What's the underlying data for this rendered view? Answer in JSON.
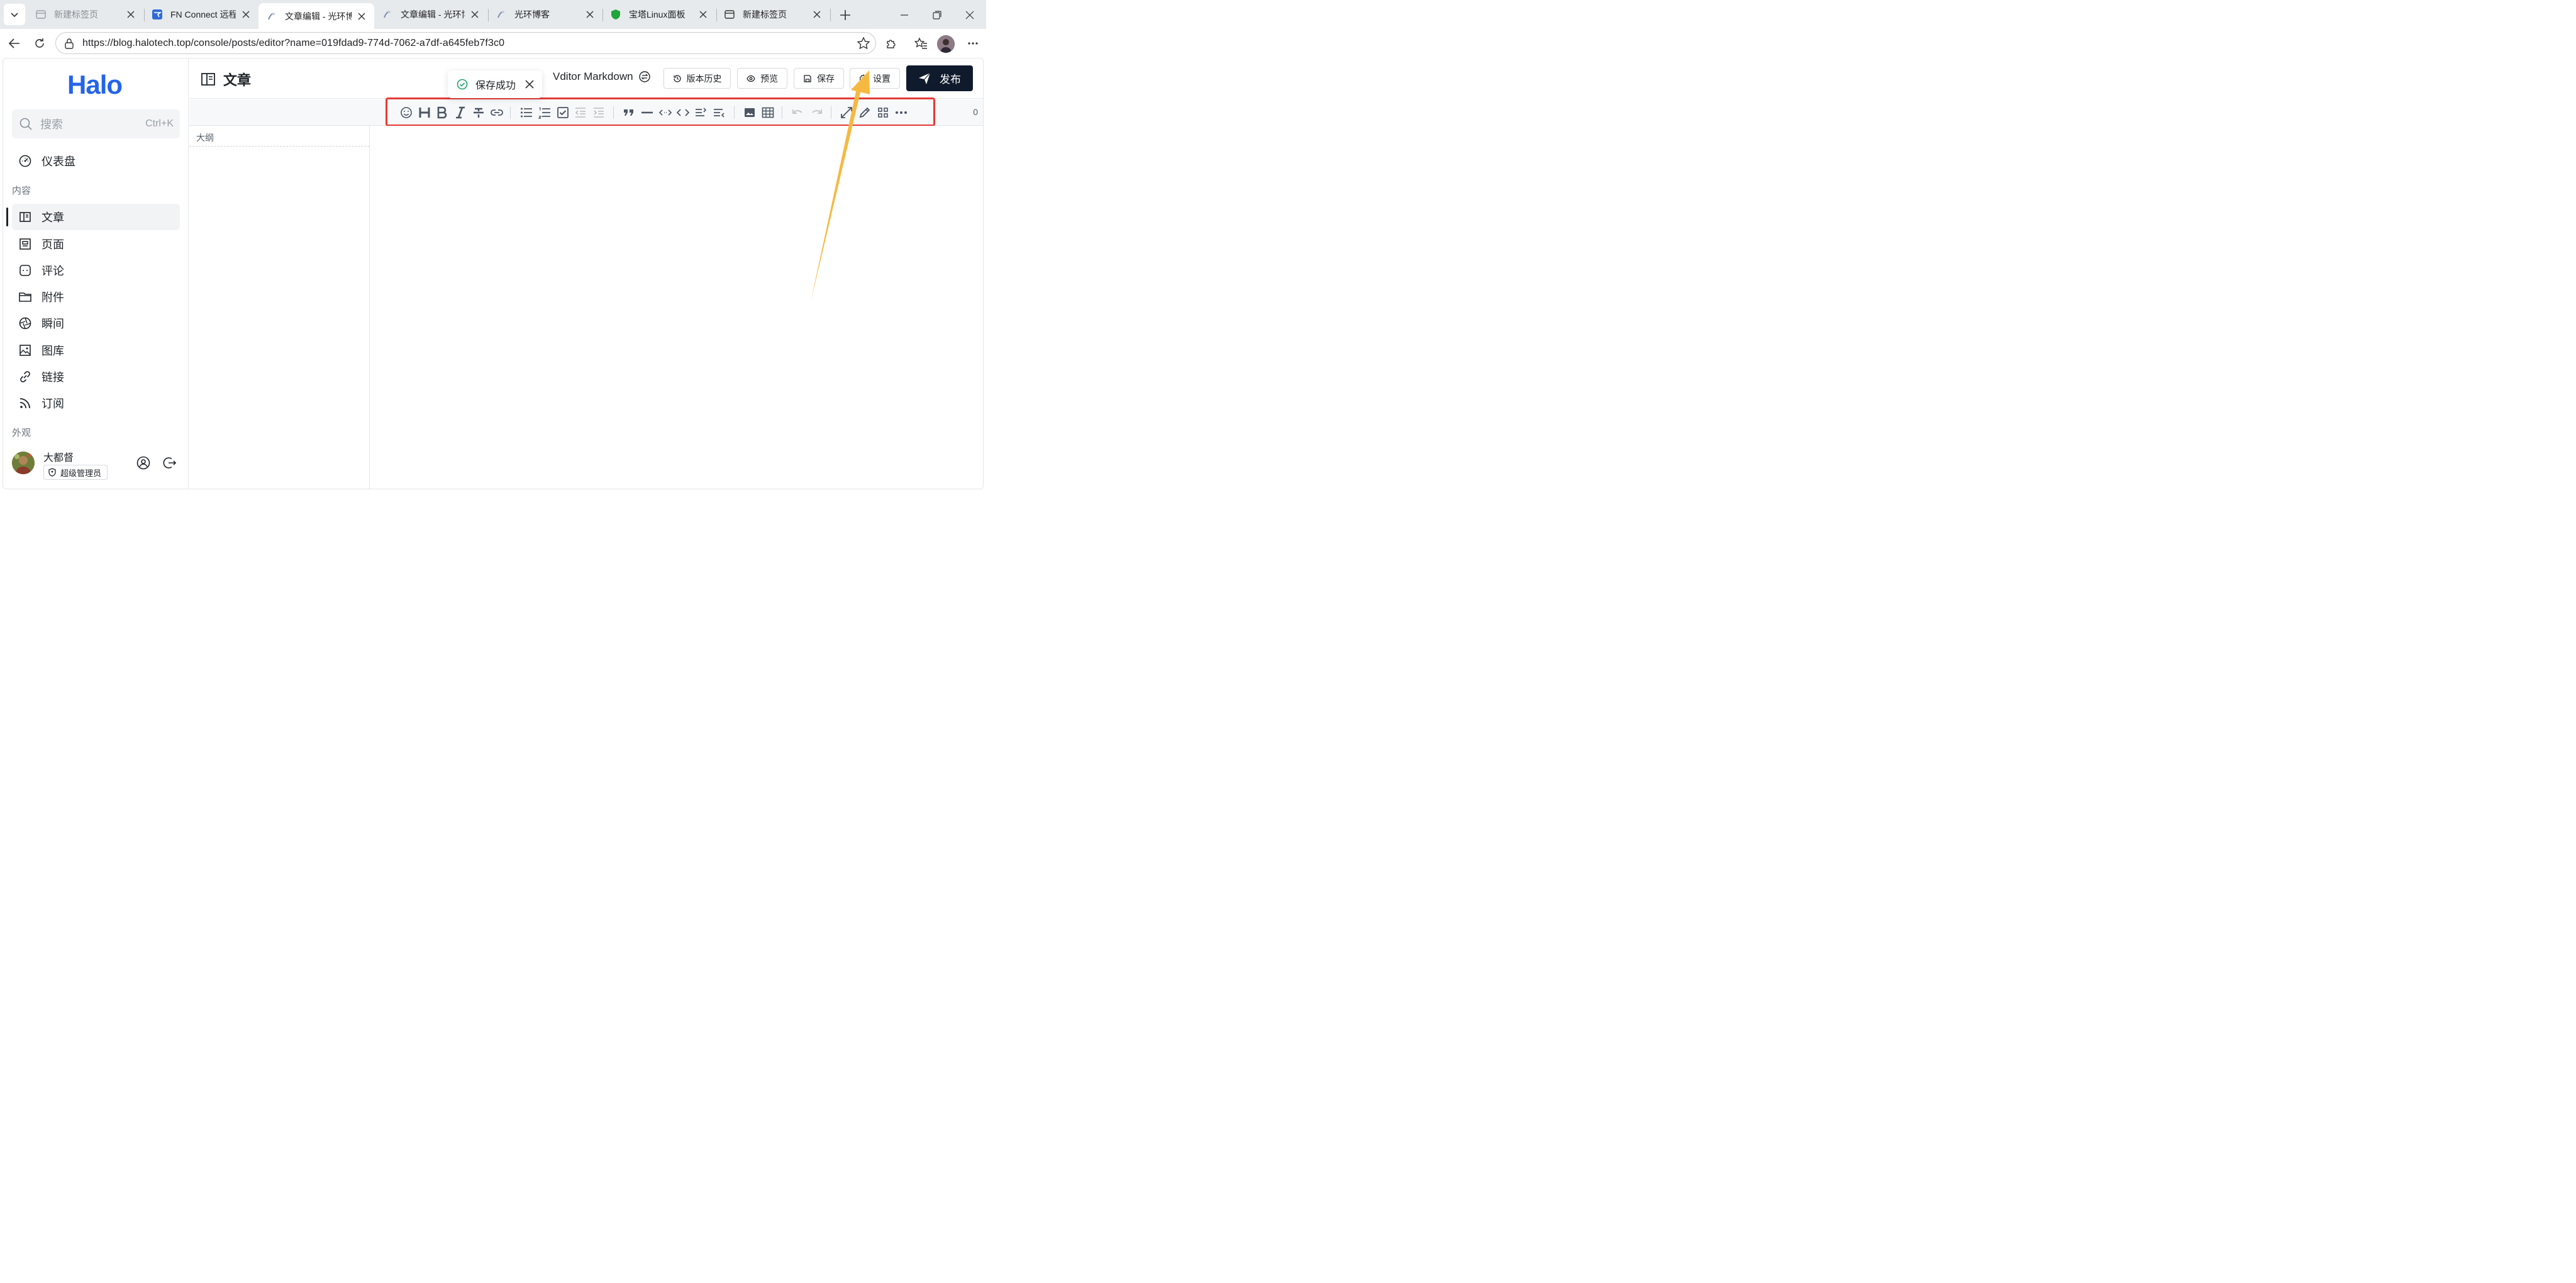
{
  "browser": {
    "tabs": [
      {
        "title": "新建标签页",
        "icon": "new-tab-page-icon",
        "state": "faded"
      },
      {
        "title": "FN Connect 远程访问",
        "icon": "fn-connect-icon",
        "state": "normal"
      },
      {
        "title": "文章编辑 - 光环博客",
        "icon": "halo-icon",
        "state": "active"
      },
      {
        "title": "文章编辑 - 光环博客",
        "icon": "halo-icon",
        "state": "normal"
      },
      {
        "title": "光环博客",
        "icon": "halo-icon",
        "state": "normal"
      },
      {
        "title": "宝塔Linux面板",
        "icon": "baota-shield-icon",
        "state": "normal"
      },
      {
        "title": "新建标签页",
        "icon": "new-tab-page-icon",
        "state": "normal"
      }
    ],
    "url": "https://blog.halotech.top/console/posts/editor?name=019fdad9-774d-7062-a7df-a645feb7f3c0"
  },
  "sidebar": {
    "logo": "Halo",
    "search": {
      "placeholder": "搜索",
      "shortcut": "Ctrl+K"
    },
    "dashboard": "仪表盘",
    "group_content": "内容",
    "items": [
      {
        "label": "文章",
        "icon": "post-icon",
        "active": true
      },
      {
        "label": "页面",
        "icon": "page-icon",
        "active": false
      },
      {
        "label": "评论",
        "icon": "comment-icon",
        "active": false
      },
      {
        "label": "附件",
        "icon": "folder-icon",
        "active": false
      },
      {
        "label": "瞬间",
        "icon": "moment-icon",
        "active": false
      },
      {
        "label": "图库",
        "icon": "image-icon",
        "active": false
      },
      {
        "label": "链接",
        "icon": "link-icon",
        "active": false
      },
      {
        "label": "订阅",
        "icon": "rss-icon",
        "active": false
      }
    ],
    "group_appearance": "外观",
    "user": {
      "name": "大都督",
      "role": "超级管理员"
    }
  },
  "header": {
    "title": "文章",
    "editor_name": "Vditor Markdown",
    "buttons": {
      "history": "版本历史",
      "preview": "预览",
      "save": "保存",
      "settings": "设置",
      "publish": "发布"
    }
  },
  "toast": {
    "message": "保存成功"
  },
  "toolbar": {
    "groups": [
      [
        "emoji-icon",
        "heading-icon",
        "bold-icon",
        "italic-icon",
        "strikethrough-icon",
        "link-icon"
      ],
      [
        "bullet-list-icon",
        "ordered-list-icon",
        "checklist-icon",
        "outdent-icon",
        "indent-icon"
      ],
      [
        "quote-icon",
        "horizontal-rule-icon",
        "inline-code-icon",
        "code-block-icon",
        "insert-after-icon",
        "insert-before-icon"
      ],
      [
        "image-upload-icon",
        "table-icon"
      ],
      [
        "undo-icon",
        "redo-icon"
      ],
      [
        "fullscreen-icon",
        "edit-mode-icon",
        "more-grid-icon",
        "more-dots-icon"
      ]
    ],
    "word_count": "0"
  },
  "outline": {
    "label": "大纲"
  },
  "colors": {
    "accent": "#2563eb",
    "publish": "#0f1b2d",
    "highlight": "#e53935",
    "annotation_arrow": "#f5b942",
    "success": "#22a06b"
  }
}
